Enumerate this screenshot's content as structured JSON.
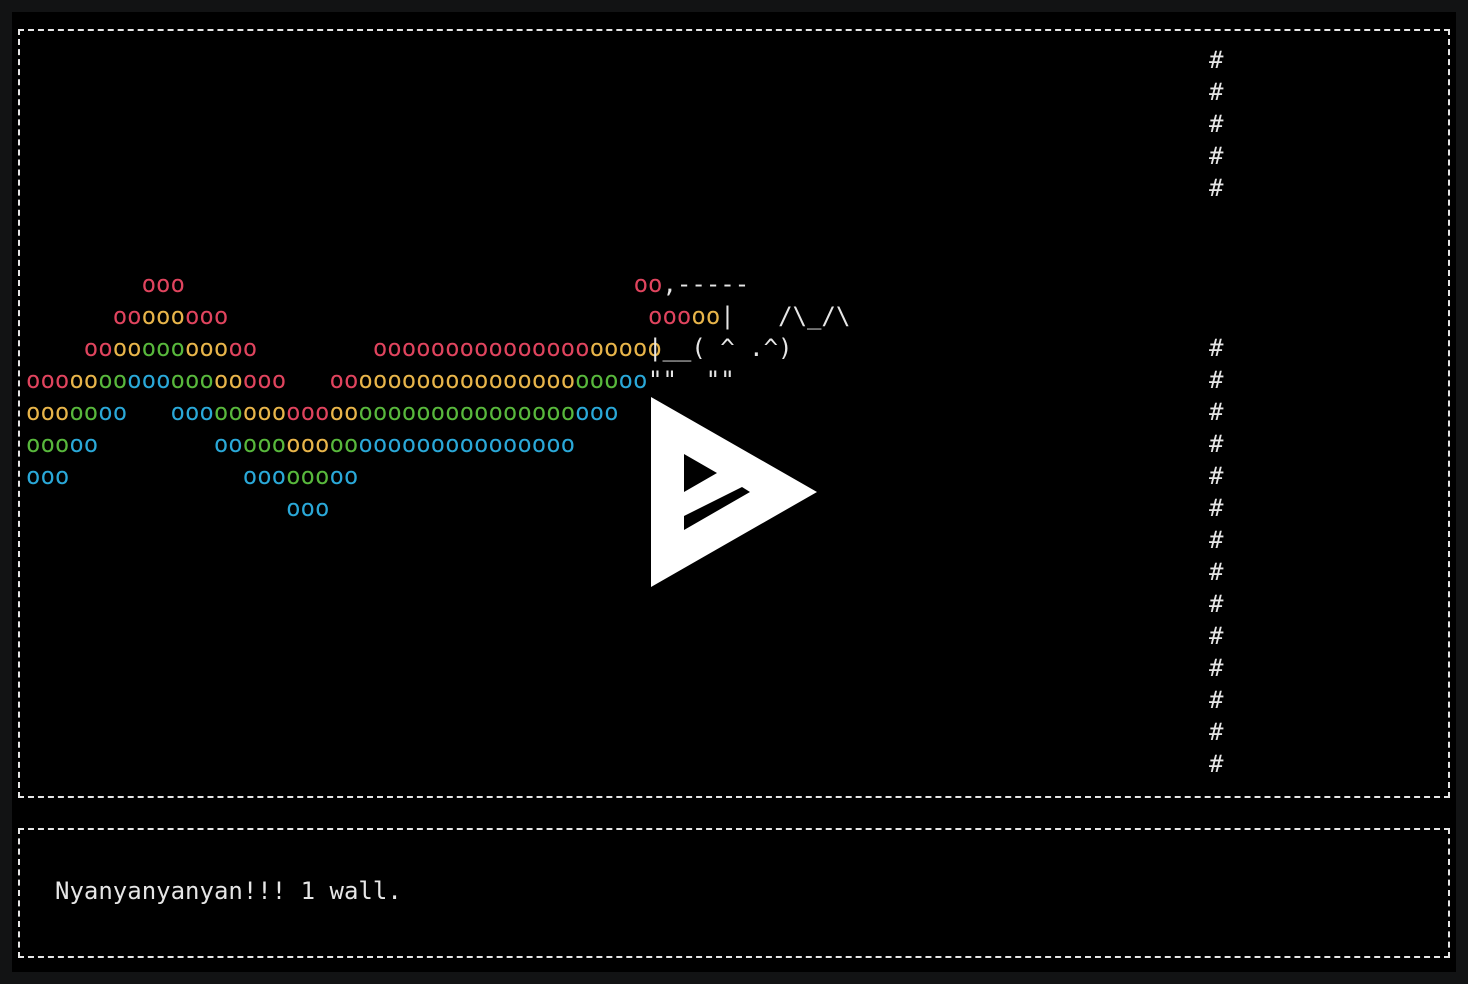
{
  "game": {
    "rainbow_rows": [
      [
        [
          "",
          "white"
        ],
        [
          "ooo",
          "red"
        ],
        [
          "",
          "white"
        ]
      ],
      [
        [
          "",
          "white"
        ],
        [
          "oo",
          "red"
        ],
        [
          "ooo",
          "orange"
        ],
        [
          "ooo",
          "red"
        ]
      ],
      [
        [
          "",
          "white"
        ],
        [
          "oo",
          "red"
        ],
        [
          "oo",
          "orange"
        ],
        [
          "ooo",
          "green"
        ],
        [
          "ooo",
          "orange"
        ],
        [
          "oo",
          "red"
        ],
        [
          "",
          "white"
        ],
        [
          "ooooooooooooooo",
          "red"
        ],
        [
          "ooooo",
          "orange"
        ]
      ],
      [
        [
          "ooo",
          "red"
        ],
        [
          "oo",
          "orange"
        ],
        [
          "oo",
          "green"
        ],
        [
          "ooo",
          "blue"
        ],
        [
          "ooo",
          "green"
        ],
        [
          "oo",
          "orange"
        ],
        [
          "ooo",
          "red"
        ],
        [
          "",
          "white"
        ],
        [
          "oo",
          "red"
        ],
        [
          "ooooooooooooooo",
          "orange"
        ],
        [
          "ooo",
          "green"
        ],
        [
          "oo",
          "blue"
        ]
      ],
      [
        [
          "ooo",
          "orange"
        ],
        [
          "oo",
          "green"
        ],
        [
          "oo",
          "blue"
        ],
        [
          "",
          "white"
        ],
        [
          "ooo",
          "blue"
        ],
        [
          "oo",
          "green"
        ],
        [
          "ooo",
          "orange"
        ],
        [
          "ooo",
          "red"
        ],
        [
          "oo",
          "orange"
        ],
        [
          "ooooooooooooooo",
          "green"
        ],
        [
          "ooo",
          "blue"
        ]
      ],
      [
        [
          "ooo",
          "green"
        ],
        [
          "oo",
          "blue"
        ],
        [
          "",
          "white"
        ],
        [
          "oo",
          "blue"
        ],
        [
          "ooo",
          "green"
        ],
        [
          "ooo",
          "orange"
        ],
        [
          "oo",
          "green"
        ],
        [
          "ooooooooooooooo",
          "blue"
        ]
      ],
      [
        [
          "ooo",
          "blue"
        ],
        [
          "",
          "white"
        ],
        [
          "ooo",
          "blue"
        ],
        [
          "ooo",
          "green"
        ],
        [
          "oo",
          "blue"
        ]
      ],
      [
        [
          "",
          "white"
        ],
        [
          "ooo",
          "blue"
        ]
      ]
    ],
    "cat_rows": [
      [
        [
          "oo",
          "red"
        ],
        [
          ",-----",
          "white"
        ]
      ],
      [
        [
          "",
          "white"
        ],
        [
          "ooo",
          "red"
        ],
        [
          "oo",
          "orange"
        ],
        [
          "|   /\\_/\\",
          "white"
        ]
      ],
      [
        [
          "|__( ^ .^)",
          "white"
        ]
      ],
      [
        [
          "\"\"  \"\"",
          "white"
        ]
      ]
    ],
    "wall_top": [
      "#",
      "#",
      "#",
      "#",
      "#"
    ],
    "wall_bottom": [
      "#",
      "#",
      "#",
      "#",
      "#",
      "#",
      "#",
      "#",
      "#",
      "#",
      "#",
      "#",
      "#",
      "#"
    ]
  },
  "status": {
    "message": "Nyanyanyanyan!!! 1 wall."
  },
  "player": {
    "play_icon": "asciinema-play-icon"
  },
  "colors": {
    "red": "#e0445e",
    "orange": "#e8b54a",
    "green": "#58b83c",
    "blue": "#2aa8d8",
    "white": "#e6e6e6",
    "background": "#000000"
  }
}
